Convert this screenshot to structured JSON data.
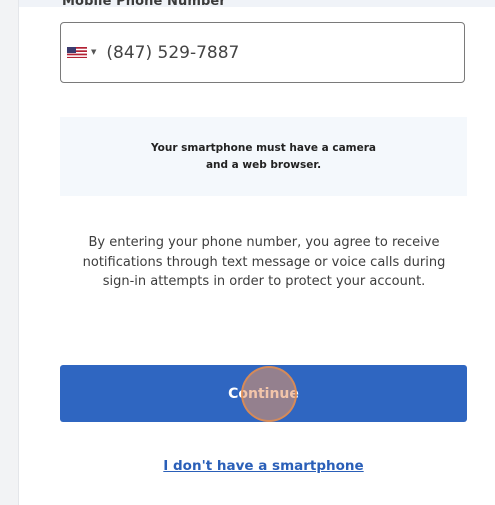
{
  "phone_field": {
    "label": "Mobile Phone Number",
    "country_flag": "us-flag-icon",
    "value": "(847) 529-7887"
  },
  "notice": {
    "text": "Your smartphone must have a camera and a web browser."
  },
  "consent": {
    "text": "By entering your phone number, you agree to receive notifications through text message or voice calls during sign-in attempts in order to protect your account."
  },
  "actions": {
    "continue_label": "Continue",
    "no_smartphone_label": "I don't have a smartphone"
  },
  "colors": {
    "primary_button": "#2f66c1",
    "link": "#2a5fb8",
    "notice_background": "#f4f8fc",
    "click_indicator": "#e89664"
  }
}
